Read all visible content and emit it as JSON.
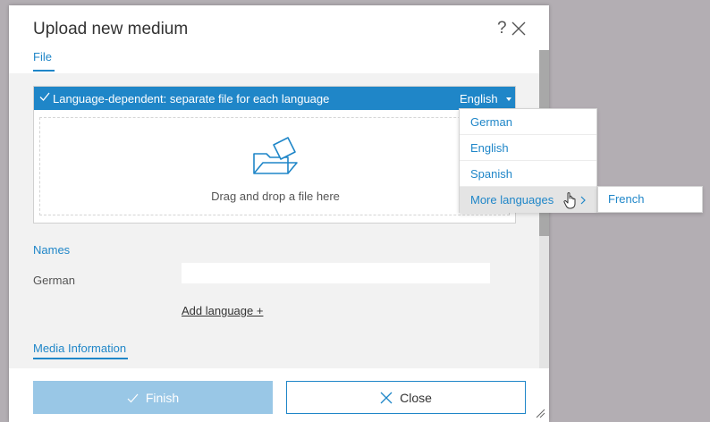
{
  "dialog": {
    "title": "Upload new medium",
    "help_label": "?"
  },
  "tabs": {
    "file": "File",
    "media_information": "Media Information"
  },
  "file_panel": {
    "language_bar_text": "Language-dependent: separate file for each language",
    "selected_language": "English",
    "drop_text": "Drag and drop a file here"
  },
  "language_dropdown": {
    "items": [
      "German",
      "English",
      "Spanish"
    ],
    "more_label": "More languages",
    "submenu_items": [
      "French"
    ]
  },
  "names": {
    "heading": "Names",
    "language_label": "German",
    "value": "",
    "add_language": "Add language +"
  },
  "footer": {
    "finish_label": "Finish",
    "close_label": "Close"
  },
  "colors": {
    "accent": "#1f86c8",
    "finish_disabled": "#99c7e6",
    "backdrop": "#b3aeb3"
  }
}
